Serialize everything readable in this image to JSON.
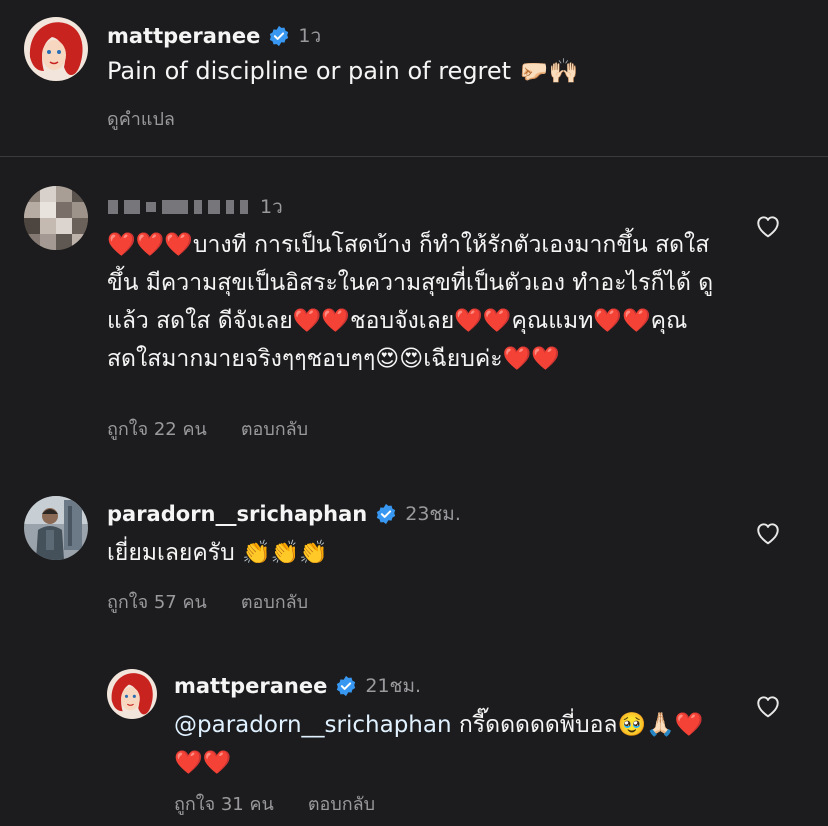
{
  "post": {
    "author": "mattperanee",
    "time": "1ว",
    "caption": "Pain of discipline or pain of regret 🤛🏻🙌🏻",
    "translate_label": "ดูคำแปล"
  },
  "comments": [
    {
      "author": "",
      "time": "1ว",
      "text": "❤️❤️❤️บางที การเป็นโสดบ้าง  ก็ทำให้รักตัวเองมากขึ้น สดใสขึ้น มีความสุขเป็นอิสระในความสุขที่เป็นตัวเอง ทำอะไรก็ได้ ดูแล้ว สดใส ดีจังเลย❤️❤️ชอบจังเลย❤️❤️คุณแมท❤️❤️คุณสดใสมากมายจริงๆๆชอบๆๆ😍😍เฉียบค่ะ❤️❤️",
      "likes": "ถูกใจ 22 คน",
      "reply": "ตอบกลับ"
    },
    {
      "author": "paradorn__srichaphan",
      "time": "23ชม.",
      "text": "เยี่ยมเลยครับ 👏👏👏",
      "likes": "ถูกใจ 57 คน",
      "reply": "ตอบกลับ"
    }
  ],
  "reply": {
    "author": "mattperanee",
    "time": "21ชม.",
    "mention": "@paradorn__srichaphan",
    "text": " กรี๊ดดดดดพี่บอล🥹🙏🏻❤️❤️❤️",
    "likes": "ถูกใจ 31 คน",
    "reply": "ตอบกลับ"
  },
  "colors": {
    "background": "#1c1c1e",
    "verified": "#3897f0",
    "secondary_text": "#9a9a9e"
  },
  "icons": [
    "verified-badge-icon",
    "heart-outline-icon"
  ]
}
